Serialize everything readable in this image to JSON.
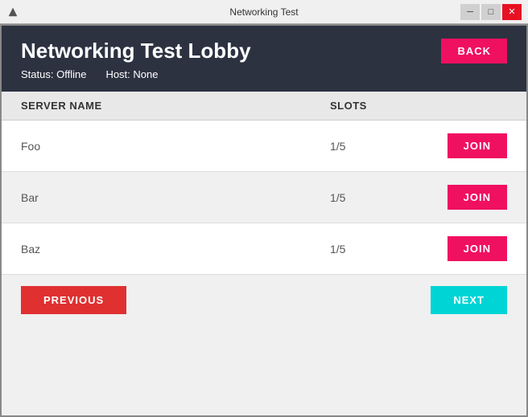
{
  "titleBar": {
    "title": "Networking Test",
    "minimizeLabel": "─",
    "maximizeLabel": "□",
    "closeLabel": "✕"
  },
  "header": {
    "title": "Networking Test Lobby",
    "backLabel": "BACK",
    "statusLabel": "Status:",
    "statusValue": "Offline",
    "hostLabel": "Host:",
    "hostValue": "None"
  },
  "table": {
    "columnServerName": "SERVER NAME",
    "columnSlots": "SLOTS"
  },
  "servers": [
    {
      "name": "Foo",
      "slots": "1/5"
    },
    {
      "name": "Bar",
      "slots": "1/5"
    },
    {
      "name": "Baz",
      "slots": "1/5"
    }
  ],
  "joinLabel": "JOIN",
  "footer": {
    "previousLabel": "PREVIOUS",
    "nextLabel": "NEXT"
  },
  "colors": {
    "joinBtn": "#f01060",
    "backBtn": "#f01060",
    "prevBtn": "#e03030",
    "nextBtn": "#00d4d4",
    "headerBg": "#2d3241",
    "closeBtn": "#e81123"
  }
}
